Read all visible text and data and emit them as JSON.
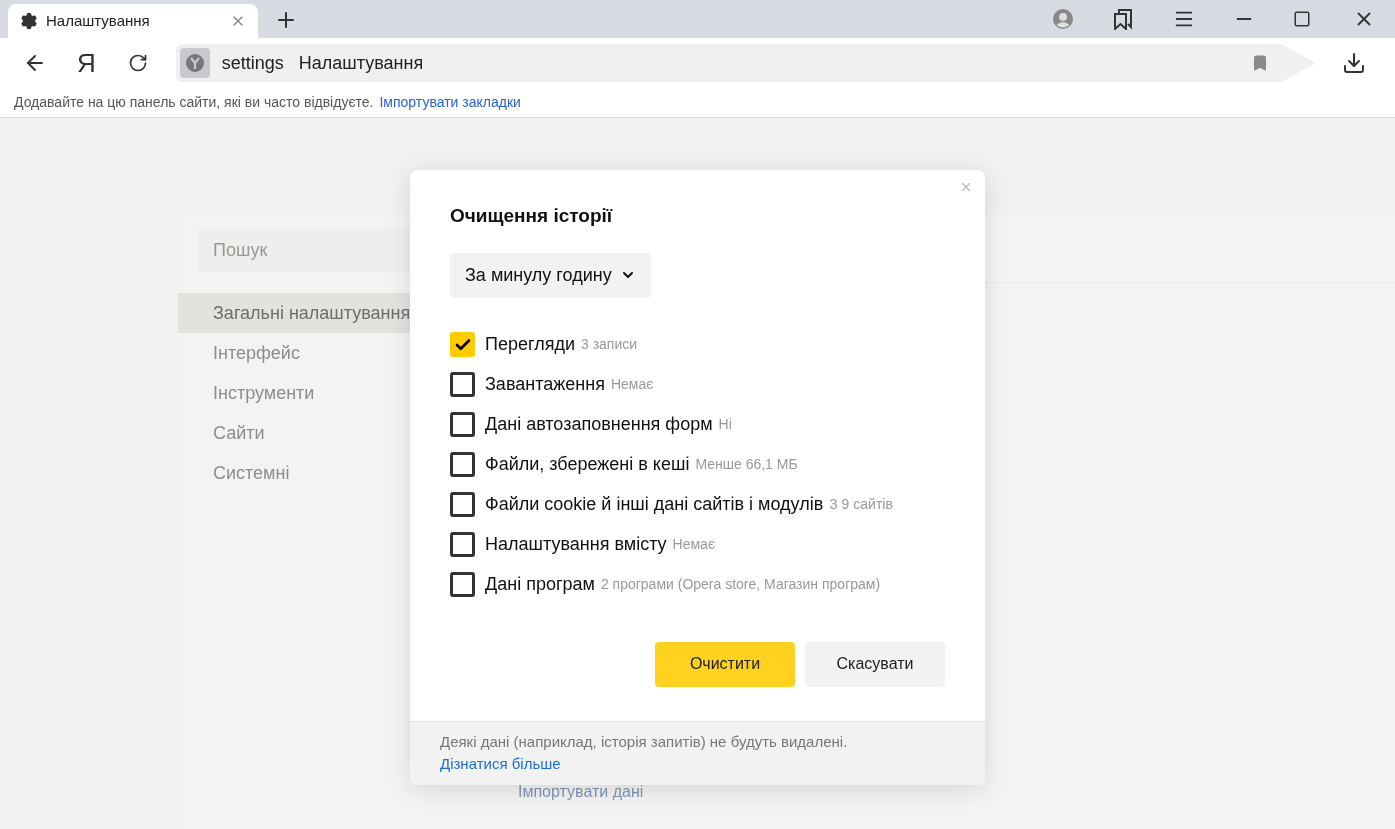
{
  "tabs": [
    {
      "title": "Налаштування",
      "selected": true
    }
  ],
  "toolbar": {
    "home_logo": "Я",
    "address": {
      "scheme": "settings",
      "title": "Налаштування"
    }
  },
  "bookmarks_bar": {
    "hint": "Додавайте на цю панель сайти, які ви часто відвідуєте.",
    "link": "Імпортувати закладки"
  },
  "settings": {
    "search": {
      "placeholder": "Пошук"
    },
    "nav": [
      {
        "label": "Загальні налаштування",
        "selected": true
      },
      {
        "label": "Інтерфейс",
        "selected": false
      },
      {
        "label": "Інструменти",
        "selected": false
      },
      {
        "label": "Сайти",
        "selected": false
      },
      {
        "label": "Системні",
        "selected": false
      }
    ],
    "content_link": "Імпортувати дані"
  },
  "dialog": {
    "title": "Очищення історії",
    "period": "За минулу годину",
    "items": [
      {
        "label": "Перегляди",
        "count": "3 записи",
        "checked": true
      },
      {
        "label": "Завантаження",
        "count": "Немає",
        "checked": false
      },
      {
        "label": "Дані автозаповнення форм",
        "count": "Ні",
        "checked": false
      },
      {
        "label": "Файли, збережені в кеші",
        "count": "Менше 66,1 МБ",
        "checked": false
      },
      {
        "label": "Файли cookie й інші дані сайтів і модулів",
        "count": "З 9 сайтів",
        "checked": false
      },
      {
        "label": "Налаштування вмісту",
        "count": "Немає",
        "checked": false
      },
      {
        "label": "Дані програм",
        "count": "2 програми (Opera store, Магазин програм)",
        "checked": false
      }
    ],
    "buttons": [
      {
        "label": "Очистити",
        "kind": "primary"
      },
      {
        "label": "Скасувати",
        "kind": "secondary"
      }
    ],
    "footer": {
      "note": "Деякі дані (наприклад, історія запитів) не будуть видалені.",
      "link": "Дізнатися більше"
    }
  }
}
